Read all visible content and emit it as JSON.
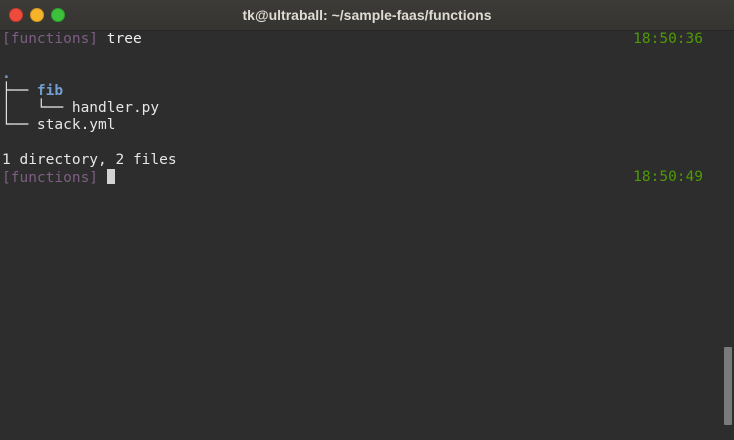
{
  "window": {
    "title": "tk@ultraball: ~/sample-faas/functions"
  },
  "terminal": {
    "cmd_line": {
      "prompt": "[functions]",
      "command": " tree",
      "time": "18:50:36"
    },
    "tree_output": {
      "root": ".",
      "dir_branch": "├── ",
      "dir_name": "fib",
      "file1_branch": "│   └── ",
      "file1_name": "handler.py",
      "file2_branch": "└── ",
      "file2_name": "stack.yml",
      "summary": "1 directory, 2 files"
    },
    "current_line": {
      "prompt": "[functions]",
      "time": "18:50:49"
    }
  },
  "colors": {
    "prompt": "#7d5e82",
    "time": "#4e9a06",
    "directory": "#729fcf",
    "background": "#2d2d2d"
  }
}
